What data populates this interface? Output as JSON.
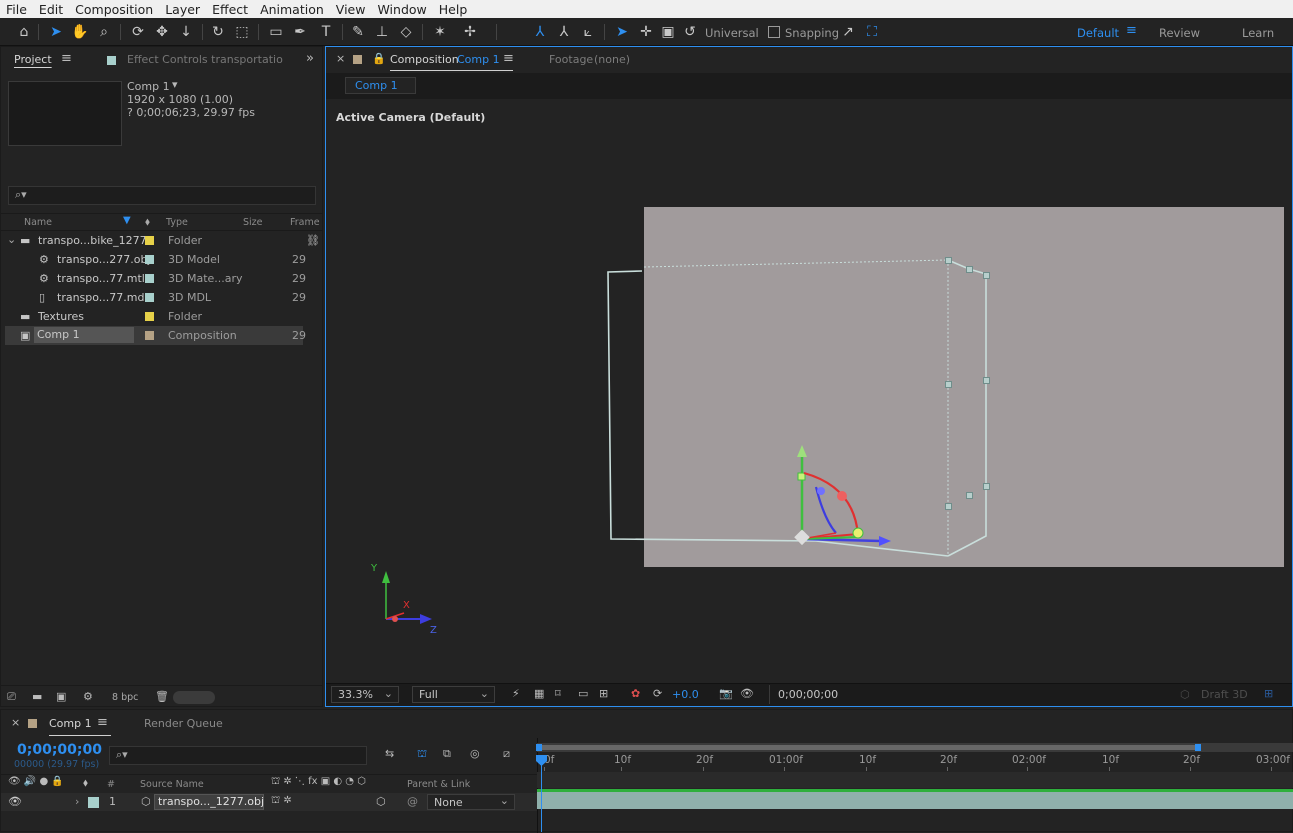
{
  "menu": [
    "File",
    "Edit",
    "Composition",
    "Layer",
    "Effect",
    "Animation",
    "View",
    "Window",
    "Help"
  ],
  "toolbar": {
    "axis_mode": "Universal",
    "snapping": "Snapping",
    "workspaces": [
      "Default",
      "Review",
      "Learn"
    ]
  },
  "project": {
    "tab": "Project",
    "effect_controls_tab": "Effect Controls transportation_b",
    "comp_name": "Comp 1",
    "comp_dims": "1920 x 1080 (1.00)",
    "comp_duration": "? 0;00;06;23, 29.97 fps",
    "columns": {
      "name": "Name",
      "type": "Type",
      "size": "Size",
      "frame": "Frame R"
    },
    "items": [
      {
        "name": "transpo...bike_1277",
        "type": "Folder",
        "frame": "",
        "color": "#e6d149",
        "icon": "folder"
      },
      {
        "name": "transpo...277.obj",
        "type": "3D Model",
        "frame": "29",
        "color": "#a8d0cc",
        "icon": "file3d"
      },
      {
        "name": "transpo...77.mtl",
        "type": "3D Mate...ary",
        "frame": "29",
        "color": "#a8d0cc",
        "icon": "file3d"
      },
      {
        "name": "transpo...77.mdl",
        "type": "3D MDL",
        "frame": "29",
        "color": "#a8d0cc",
        "icon": "file"
      },
      {
        "name": "Textures",
        "type": "Folder",
        "frame": "",
        "color": "#e6d149",
        "icon": "folder"
      },
      {
        "name": "Comp 1",
        "type": "Composition",
        "frame": "29",
        "color": "#b5a285",
        "icon": "comp"
      }
    ],
    "bpc": "8 bpc"
  },
  "composition": {
    "tab_prefix": "Composition",
    "tab_name": "Comp 1",
    "footage_tab": "Footage",
    "footage_value": "(none)",
    "comp_chip": "Comp 1",
    "camera_label": "Active Camera (Default)",
    "zoom": "33.3%",
    "resolution": "Full",
    "exposure": "+0.0",
    "timecode": "0;00;00;00",
    "renderer": "Draft 3D",
    "axis_labels": {
      "x": "X",
      "y": "Y",
      "z": "Z"
    }
  },
  "timeline": {
    "tab": "Comp 1",
    "render_queue": "Render Queue",
    "current_time": "0;00;00;00",
    "frames_fps": "00000 (29.97 fps)",
    "columns": {
      "num": "#",
      "source": "Source Name",
      "parent": "Parent & Link"
    },
    "ruler": [
      "0f",
      "10f",
      "20f",
      "01:00f",
      "10f",
      "20f",
      "02:00f",
      "10f",
      "20f",
      "03:00f"
    ],
    "layer": {
      "num": "1",
      "name": "transpo..._1277.obj",
      "parent": "None",
      "color": "#a8d0cc"
    }
  },
  "colors": {
    "accent": "#2e8ff0",
    "panel_bg": "#232323",
    "viewer_bg": "#a19b9c"
  }
}
